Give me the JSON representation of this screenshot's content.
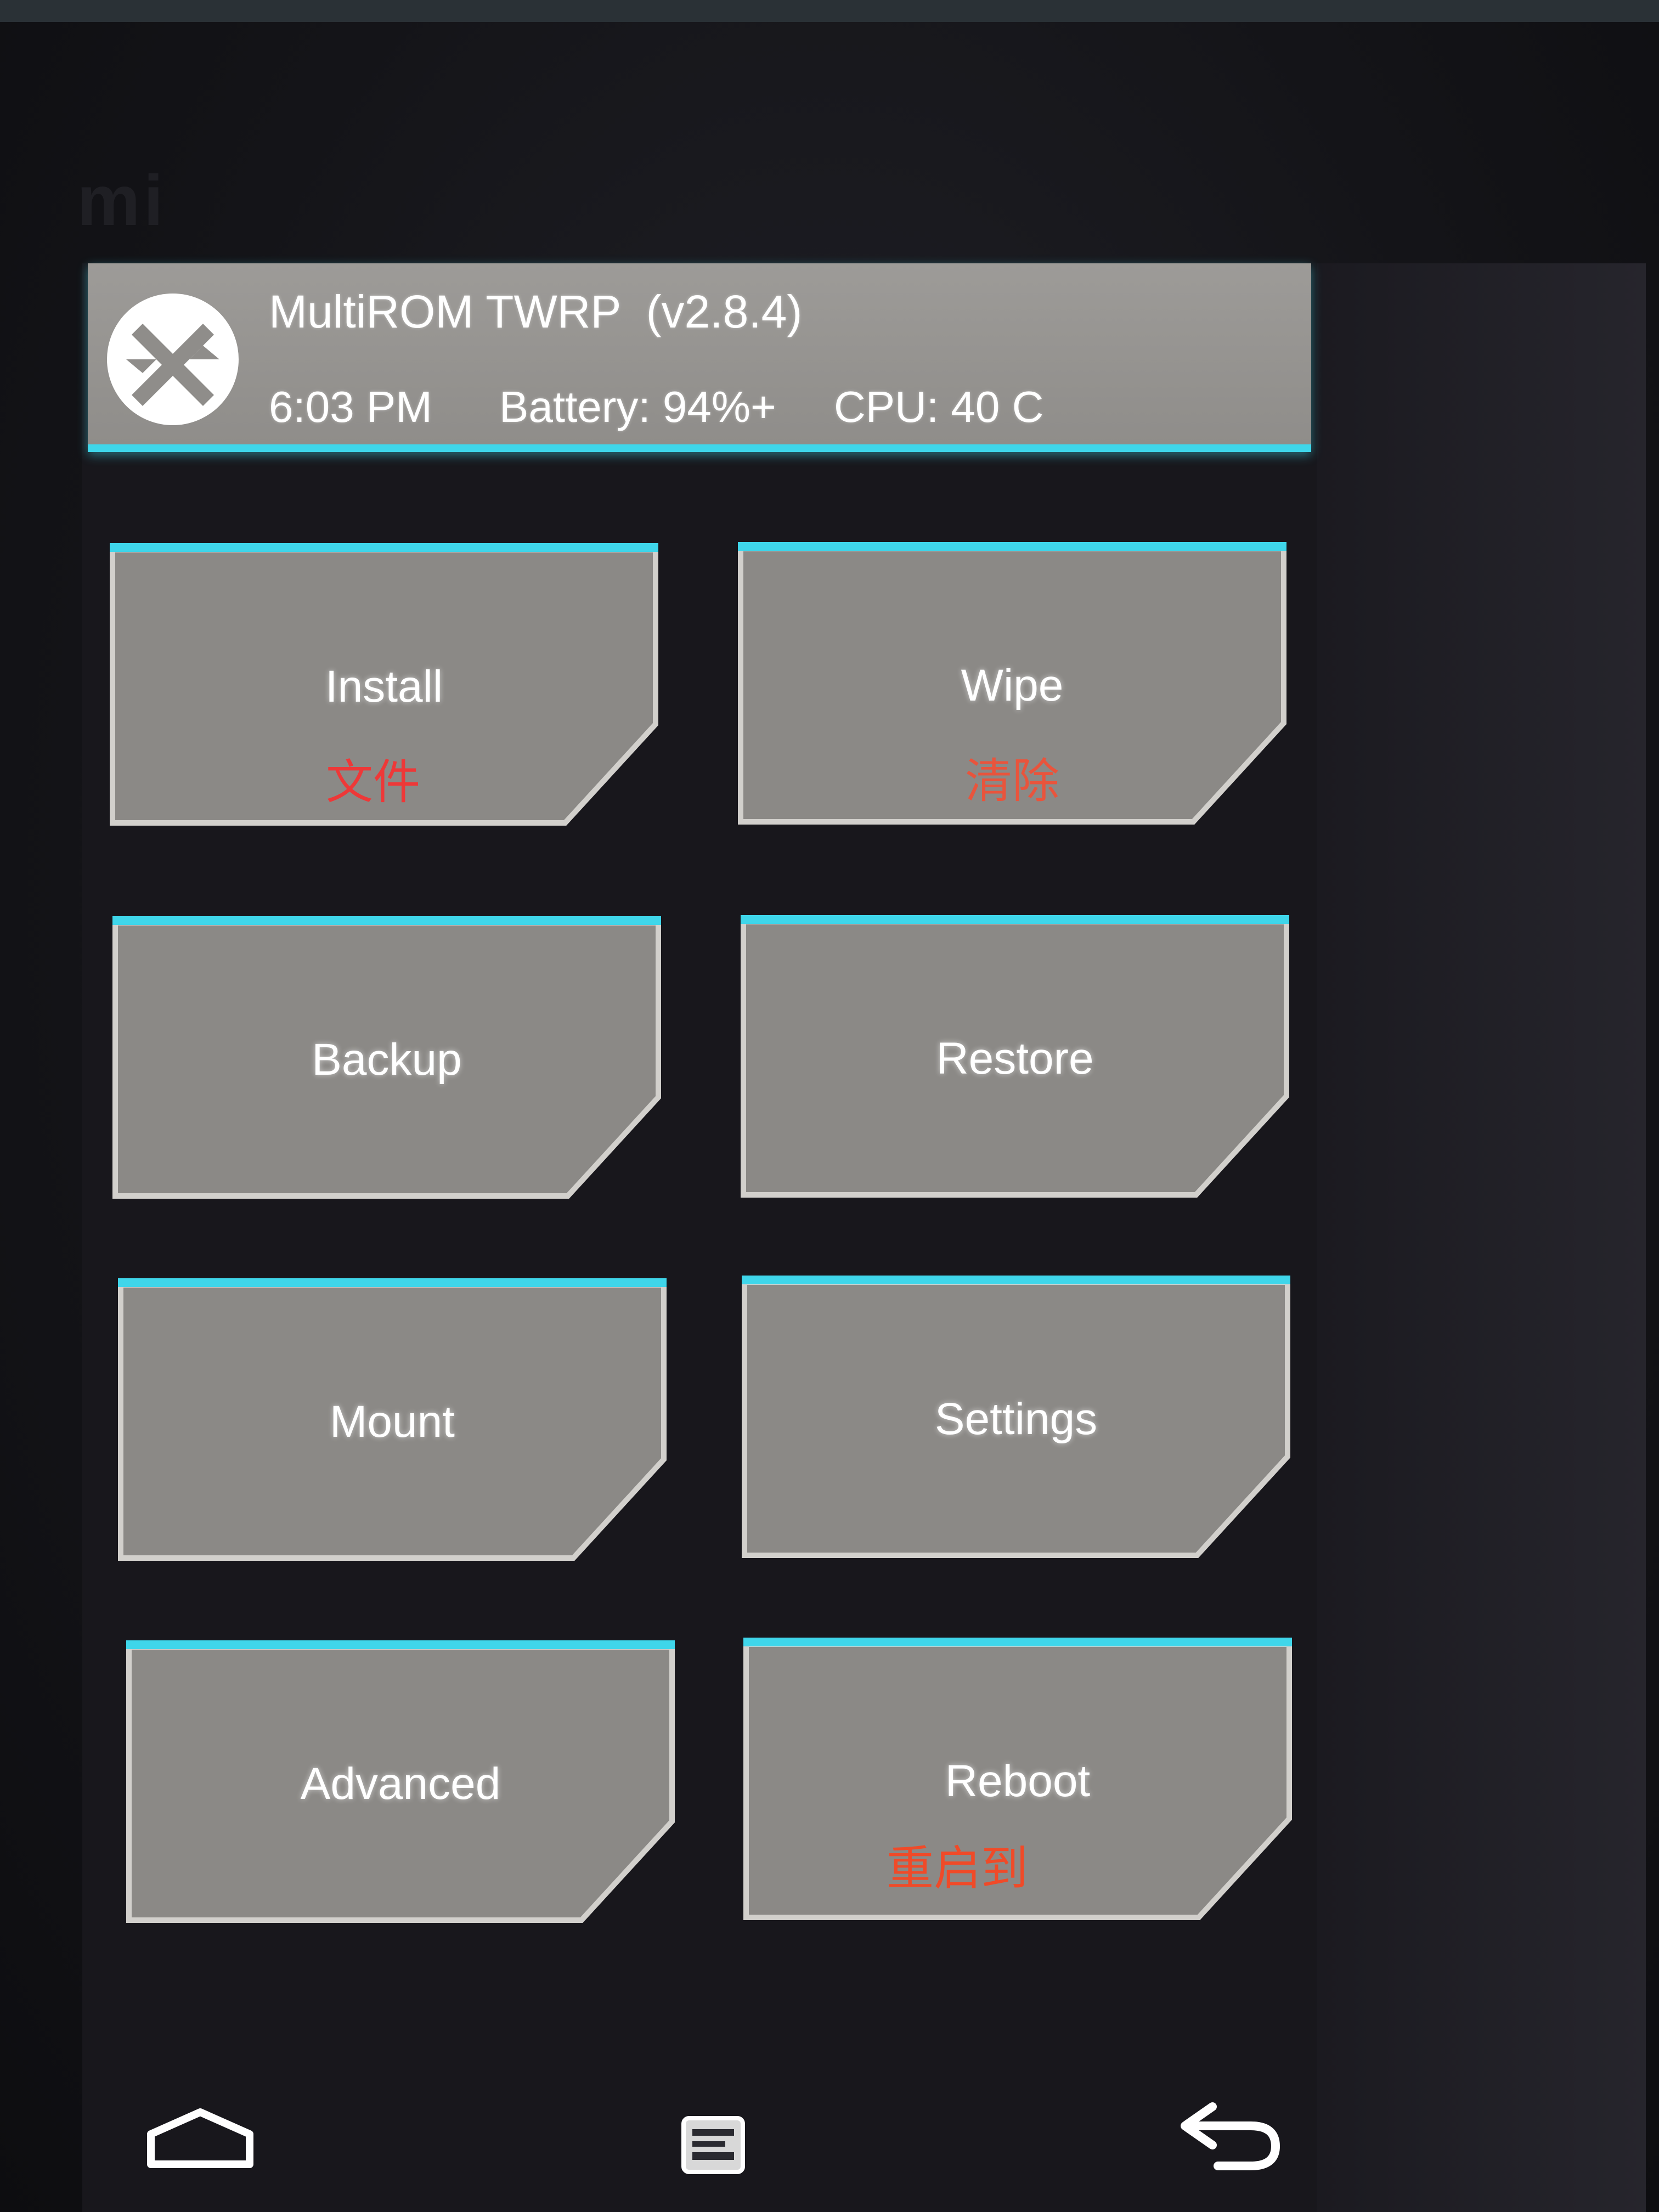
{
  "brand_mark": "mi",
  "header": {
    "title": "MultiROM TWRP  (v2.8.4)",
    "time": "6:03 PM",
    "battery": "Battery: 94%+",
    "cpu": "CPU: 40 C",
    "logo_icon": "twrp-logo-icon"
  },
  "tiles": [
    {
      "label": "Install",
      "sub": "文件"
    },
    {
      "label": "Wipe",
      "sub": "清除"
    },
    {
      "label": "Backup",
      "sub": ""
    },
    {
      "label": "Restore",
      "sub": ""
    },
    {
      "label": "Mount",
      "sub": ""
    },
    {
      "label": "Settings",
      "sub": ""
    },
    {
      "label": "Advanced",
      "sub": ""
    },
    {
      "label": "Reboot",
      "sub": "重启到"
    }
  ],
  "nav": {
    "icons": [
      "home-icon",
      "console-icon",
      "back-icon"
    ]
  },
  "colors": {
    "accent": "#3fd6ea",
    "tile": "#8b8986",
    "header": "#9a9895",
    "annotation_red": "#ee3838"
  }
}
